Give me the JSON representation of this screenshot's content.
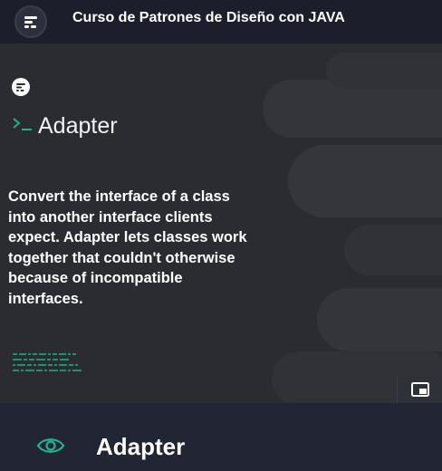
{
  "header": {
    "course_title": "Curso de Patrones de Diseño con JAVA",
    "logo_icon": "platzi-logo-icon"
  },
  "video": {
    "slide_logo_icon": "platzi-logo-icon",
    "prompt_icon": "terminal-prompt-icon",
    "slide_title": "Adapter",
    "slide_body": "Convert the interface of a class into another interface clients expect. Adapter lets classes work together that couldn't otherwise because of incompatible interfaces.",
    "pip_icon": "picture-in-picture-icon"
  },
  "lesson": {
    "eye_icon": "eye-icon",
    "title": "Adapter"
  },
  "colors": {
    "accent_green": "#21b28b",
    "header_bg": "#1c1f2b",
    "video_bg": "#2b2c31",
    "bottom_bg": "#222534"
  }
}
